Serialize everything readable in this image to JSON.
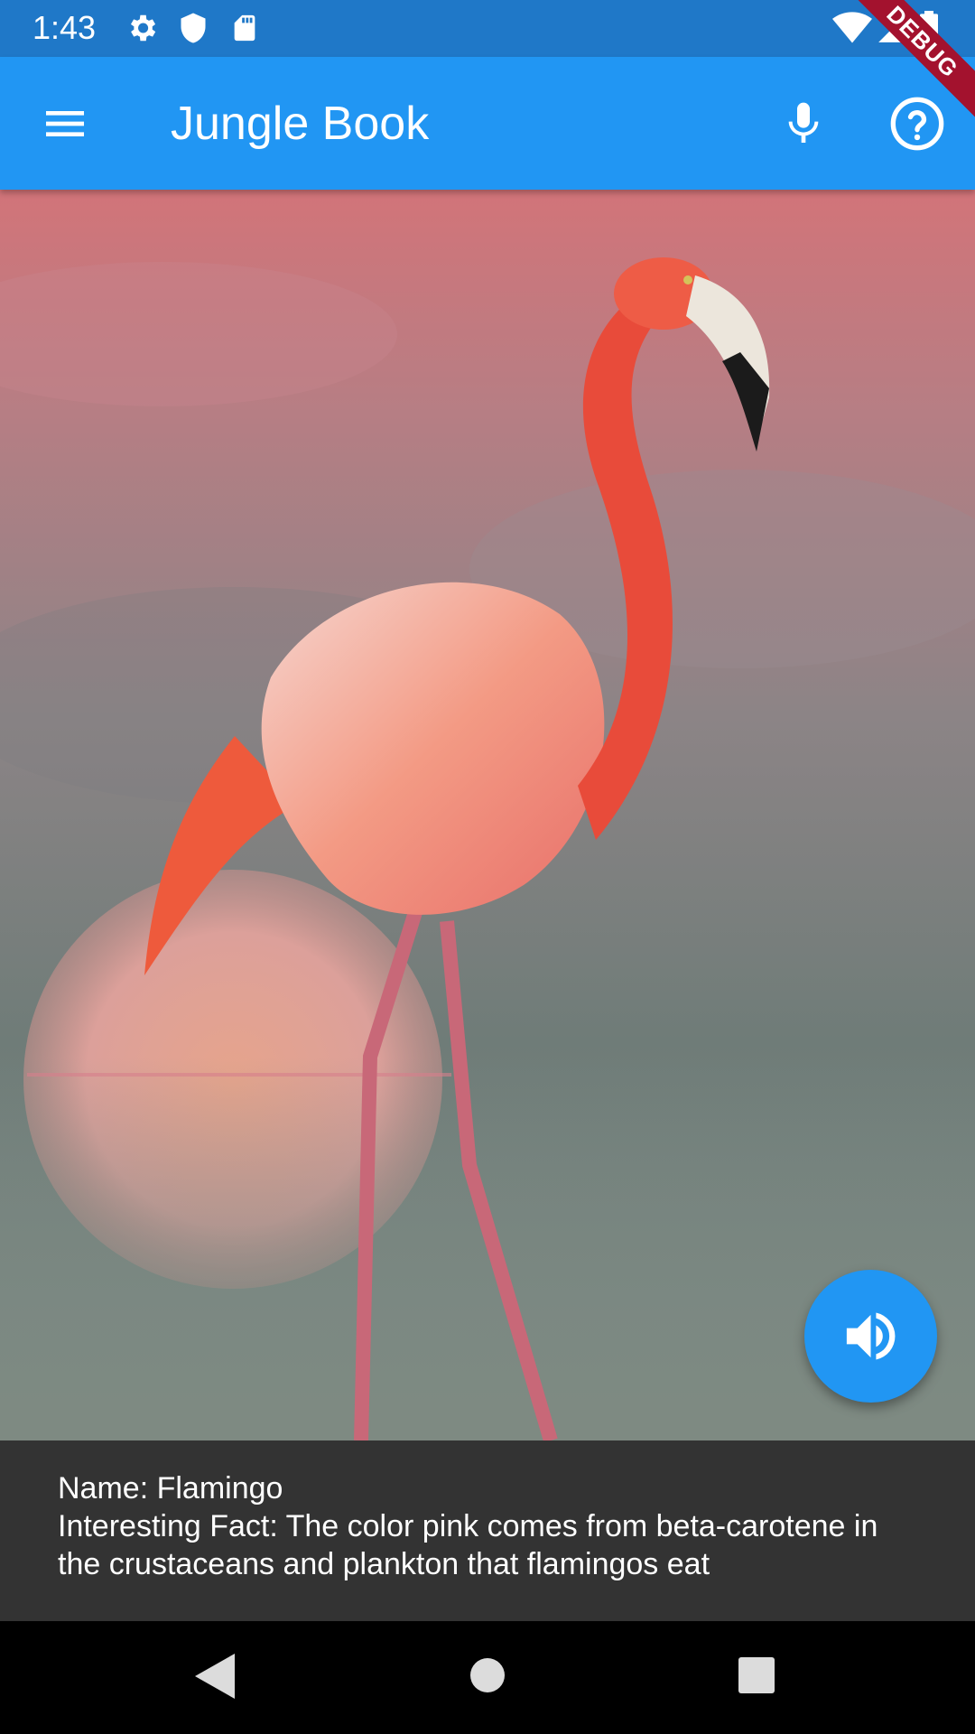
{
  "status_bar": {
    "time": "1:43",
    "icons_left": [
      "settings-icon",
      "shield-icon",
      "sd-card-icon"
    ],
    "icons_right": [
      "wifi-icon",
      "signal-icon",
      "battery-icon"
    ]
  },
  "debug_banner": "DEBUG",
  "app_bar": {
    "title": "Jungle Book",
    "menu_icon": "menu-icon",
    "actions": [
      "microphone-icon",
      "help-icon"
    ],
    "color": "#2196f3"
  },
  "animal": {
    "name_line": "Name: Flamingo",
    "fact_line": "Interesting Fact: The color pink comes from beta-carotene in the crustaceans and plankton that flamingos eat"
  },
  "fab": {
    "icon": "volume-up-icon",
    "color": "#2196f3"
  },
  "nav_bar": {
    "buttons": [
      "back-icon",
      "home-icon",
      "recents-icon"
    ]
  }
}
